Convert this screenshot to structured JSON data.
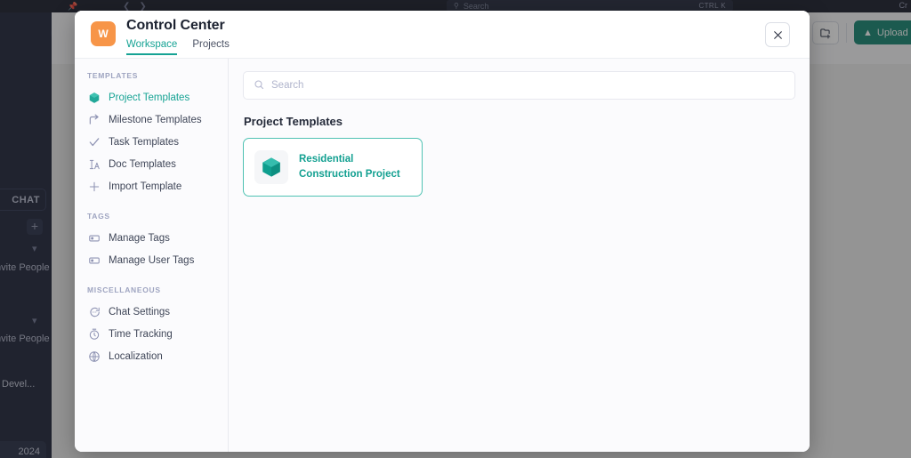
{
  "background": {
    "topbar": {
      "search_placeholder": "Search",
      "shortcut": "CTRL K",
      "pin_icon": "pin-icon",
      "back_icon": "chevron-left-icon",
      "forward_icon": "chevron-right-icon",
      "right_label": "Cr"
    },
    "left_rail": {
      "chat_label": "CHAT",
      "add_label": "+",
      "invite_1": "Invite People",
      "invite_2": "Invite People",
      "item_dev": "Devel...",
      "year": "2024",
      "collapse_icon": "chevron-left-icon"
    },
    "toolbar": {
      "folder_add_icon": "folder-add-icon",
      "upload_label": "Upload Fi"
    }
  },
  "modal": {
    "avatar_initial": "W",
    "title": "Control Center",
    "close_label": "✕",
    "tabs": [
      {
        "label": "Workspace",
        "active": true
      },
      {
        "label": "Projects",
        "active": false
      }
    ],
    "sidebar": {
      "groups": [
        {
          "title": "TEMPLATES",
          "items": [
            {
              "label": "Project Templates",
              "icon": "cube-icon",
              "active": true
            },
            {
              "label": "Milestone Templates",
              "icon": "arrow-turn-right-icon",
              "active": false
            },
            {
              "label": "Task Templates",
              "icon": "check-icon",
              "active": false
            },
            {
              "label": "Doc Templates",
              "icon": "text-format-icon",
              "active": false
            },
            {
              "label": "Import Template",
              "icon": "plus-icon",
              "active": false
            }
          ]
        },
        {
          "title": "TAGS",
          "items": [
            {
              "label": "Manage Tags",
              "icon": "tag-icon",
              "active": false
            },
            {
              "label": "Manage User Tags",
              "icon": "tag-icon",
              "active": false
            }
          ]
        },
        {
          "title": "MISCELLANEOUS",
          "items": [
            {
              "label": "Chat Settings",
              "icon": "chat-bubble-icon",
              "active": false
            },
            {
              "label": "Time Tracking",
              "icon": "timer-icon",
              "active": false
            },
            {
              "label": "Localization",
              "icon": "globe-icon",
              "active": false
            }
          ]
        }
      ]
    },
    "search": {
      "value": "",
      "placeholder": "Search",
      "icon": "search-icon"
    },
    "section_title": "Project Templates",
    "templates": [
      {
        "line1": "Residential",
        "line2": "Construction Project",
        "icon": "cube-icon"
      }
    ]
  },
  "colors": {
    "accent_teal": "#16a394",
    "card_border": "#4fc2b3",
    "avatar_orange": "#f79548",
    "upload_green": "#12836f",
    "dark_chrome": "#1b2035"
  }
}
